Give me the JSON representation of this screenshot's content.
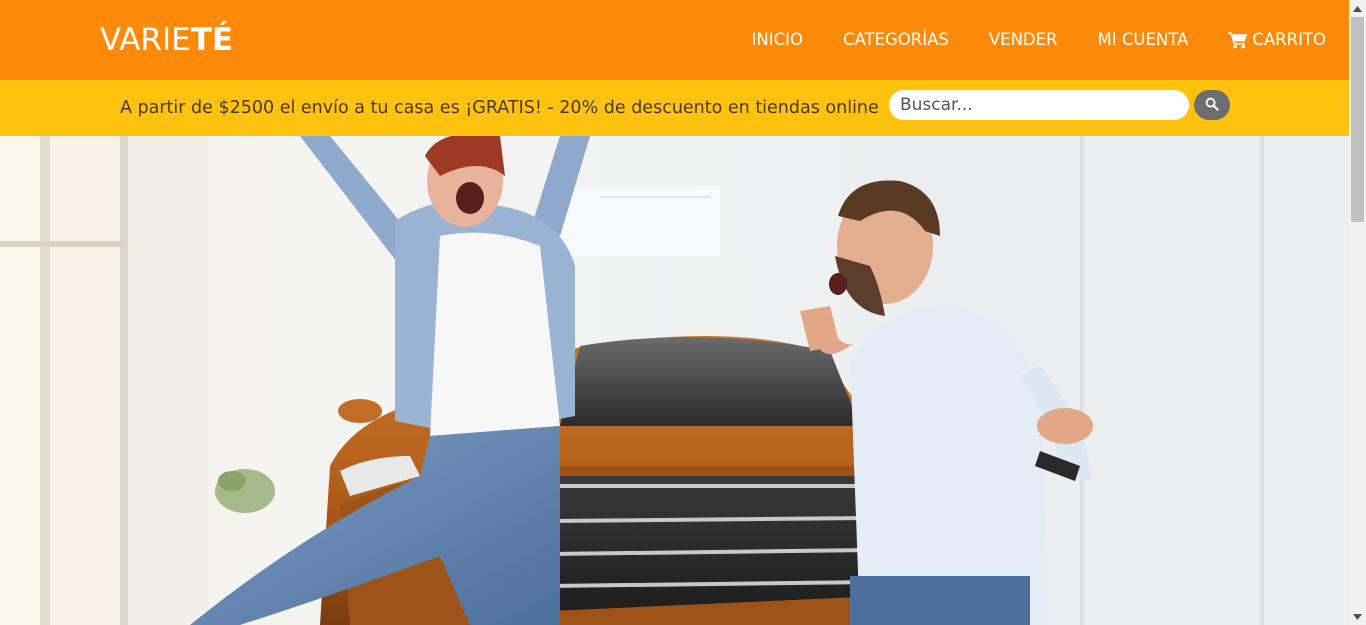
{
  "brand": {
    "logo_light": "VARIE",
    "logo_bold": "TÉ",
    "primary_color": "#ff8a0a",
    "secondary_color": "#ffc20e"
  },
  "nav": {
    "items": [
      {
        "label": "INICIO"
      },
      {
        "label": "CATEGORÍAS"
      },
      {
        "label": "VENDER"
      },
      {
        "label": "MI CUENTA"
      },
      {
        "label": "CARRITO",
        "icon": "shopping-cart-icon"
      }
    ]
  },
  "promo": {
    "text": "A partir de $2500 el envío a tu casa es ¡GRATIS! - 20% de descuento en tiendas online"
  },
  "search": {
    "placeholder": "Buscar...",
    "value": "",
    "button_icon": "search-icon"
  },
  "hero": {
    "image": "celebrating-couple-car-dealership-photo"
  }
}
